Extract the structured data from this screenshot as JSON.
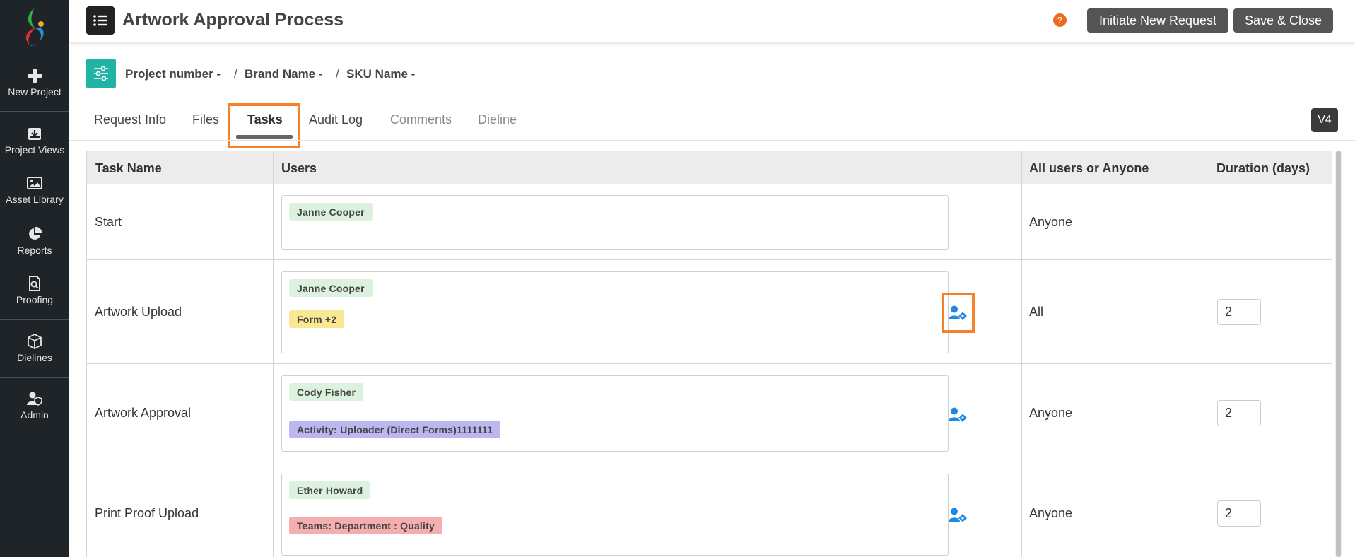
{
  "sidebar": {
    "items": [
      {
        "label": "New Project",
        "icon": "plus-icon"
      },
      {
        "label": "Project Views",
        "icon": "tray-download-icon"
      },
      {
        "label": "Asset Library",
        "icon": "image-icon"
      },
      {
        "label": "Reports",
        "icon": "pie-chart-icon"
      },
      {
        "label": "Proofing",
        "icon": "document-search-icon"
      },
      {
        "label": "Dielines",
        "icon": "box-icon"
      },
      {
        "label": "Admin",
        "icon": "user-shield-icon"
      }
    ]
  },
  "header": {
    "title": "Artwork Approval Process",
    "help": "?",
    "initiate_label": "Initiate New Request",
    "save_close_label": "Save & Close"
  },
  "breadcrumb": {
    "project": "Project number -",
    "brand": "Brand Name -",
    "sku": "SKU Name -",
    "separator": "/"
  },
  "tabs": [
    {
      "label": "Request Info",
      "state": "normal"
    },
    {
      "label": "Files",
      "state": "normal"
    },
    {
      "label": "Tasks",
      "state": "active"
    },
    {
      "label": "Audit Log",
      "state": "normal"
    },
    {
      "label": "Comments",
      "state": "disabled"
    },
    {
      "label": "Dieline",
      "state": "disabled"
    }
  ],
  "version": "V4",
  "table": {
    "columns": [
      "Task Name",
      "Users",
      "All users or Anyone",
      "Duration (days)"
    ],
    "rows": [
      {
        "task": "Start",
        "chips": [
          {
            "text": "Janne Cooper",
            "color": "green"
          }
        ],
        "mode": "Anyone",
        "duration": ""
      },
      {
        "task": "Artwork Upload",
        "chips": [
          {
            "text": "Janne Cooper",
            "color": "green"
          },
          {
            "text": "Form +2",
            "color": "yellow"
          }
        ],
        "mode": "All",
        "duration": "2"
      },
      {
        "task": "Artwork Approval",
        "chips": [
          {
            "text": "Cody Fisher",
            "color": "green"
          },
          {
            "text": "Activity: Uploader (Direct Forms)1111111",
            "color": "purple"
          }
        ],
        "mode": "Anyone",
        "duration": "2"
      },
      {
        "task": "Print Proof Upload",
        "chips": [
          {
            "text": "Ether Howard",
            "color": "green"
          },
          {
            "text": "Teams: Department : Quality",
            "color": "red"
          }
        ],
        "mode": "Anyone",
        "duration": "2"
      }
    ]
  },
  "colors": {
    "sidebar_bg": "#1f2429",
    "accent_teal": "#21b3a5",
    "highlight_orange": "#f5822a",
    "cog_blue": "#1e88e5",
    "help_orange": "#ee6a1c"
  }
}
